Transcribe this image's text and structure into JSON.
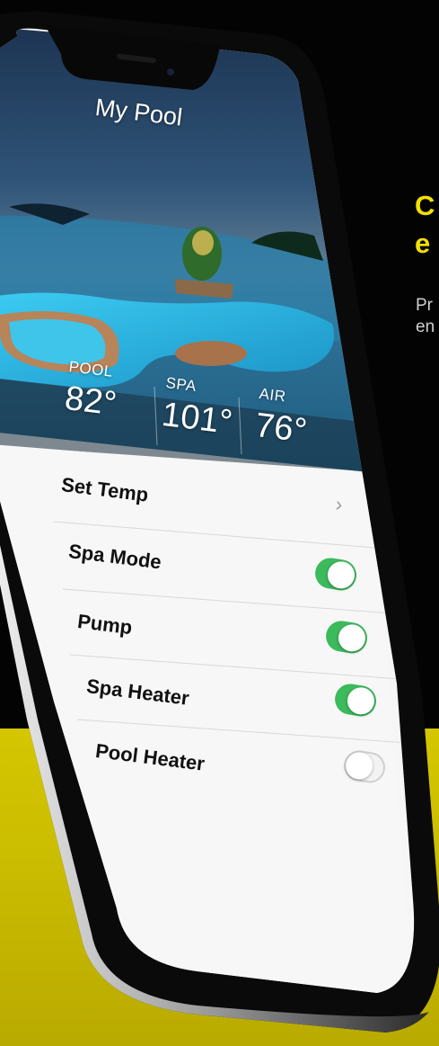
{
  "promo": {
    "headline": "C\ne",
    "headline_line1": "C",
    "headline_line2": "e",
    "subtext_line1": "Pr",
    "subtext_line2": "en"
  },
  "app": {
    "title": "My Pool"
  },
  "temps": [
    {
      "label": "POOL",
      "value": "82°"
    },
    {
      "label": "SPA",
      "value": "101°"
    },
    {
      "label": "AIR",
      "value": "76°"
    }
  ],
  "rows": [
    {
      "label": "Set Temp",
      "control": "chevron",
      "chevron": "›"
    },
    {
      "label": "Spa Mode",
      "control": "toggle",
      "state": "on"
    },
    {
      "label": "Pump",
      "control": "toggle",
      "state": "on"
    },
    {
      "label": "Spa Heater",
      "control": "toggle",
      "state": "on"
    },
    {
      "label": "Pool Heater",
      "control": "toggle",
      "state": "off"
    }
  ],
  "colors": {
    "accent_yellow": "#f2e100",
    "toggle_on": "#3cba5c",
    "background": "#030303"
  }
}
